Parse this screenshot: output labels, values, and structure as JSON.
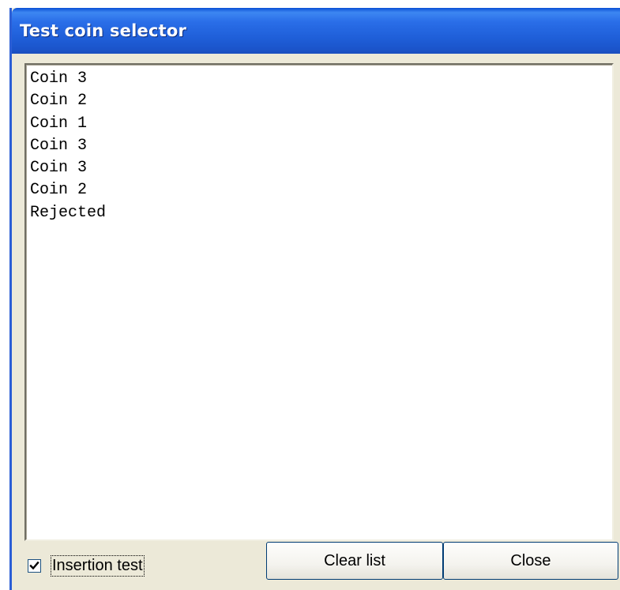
{
  "window": {
    "title": "Test coin selector"
  },
  "list": {
    "items": [
      "Coin 3",
      "Coin 2",
      "Coin 1",
      "Coin 3",
      "Coin 3",
      "Coin 2",
      "Rejected"
    ]
  },
  "checkbox": {
    "label": "Insertion test",
    "checked": true
  },
  "buttons": {
    "clear_label": "Clear list",
    "close_label": "Close"
  },
  "colors": {
    "titlebar": "#2a6ee8",
    "window_bg": "#ece9d8",
    "button_border": "#003c74"
  }
}
